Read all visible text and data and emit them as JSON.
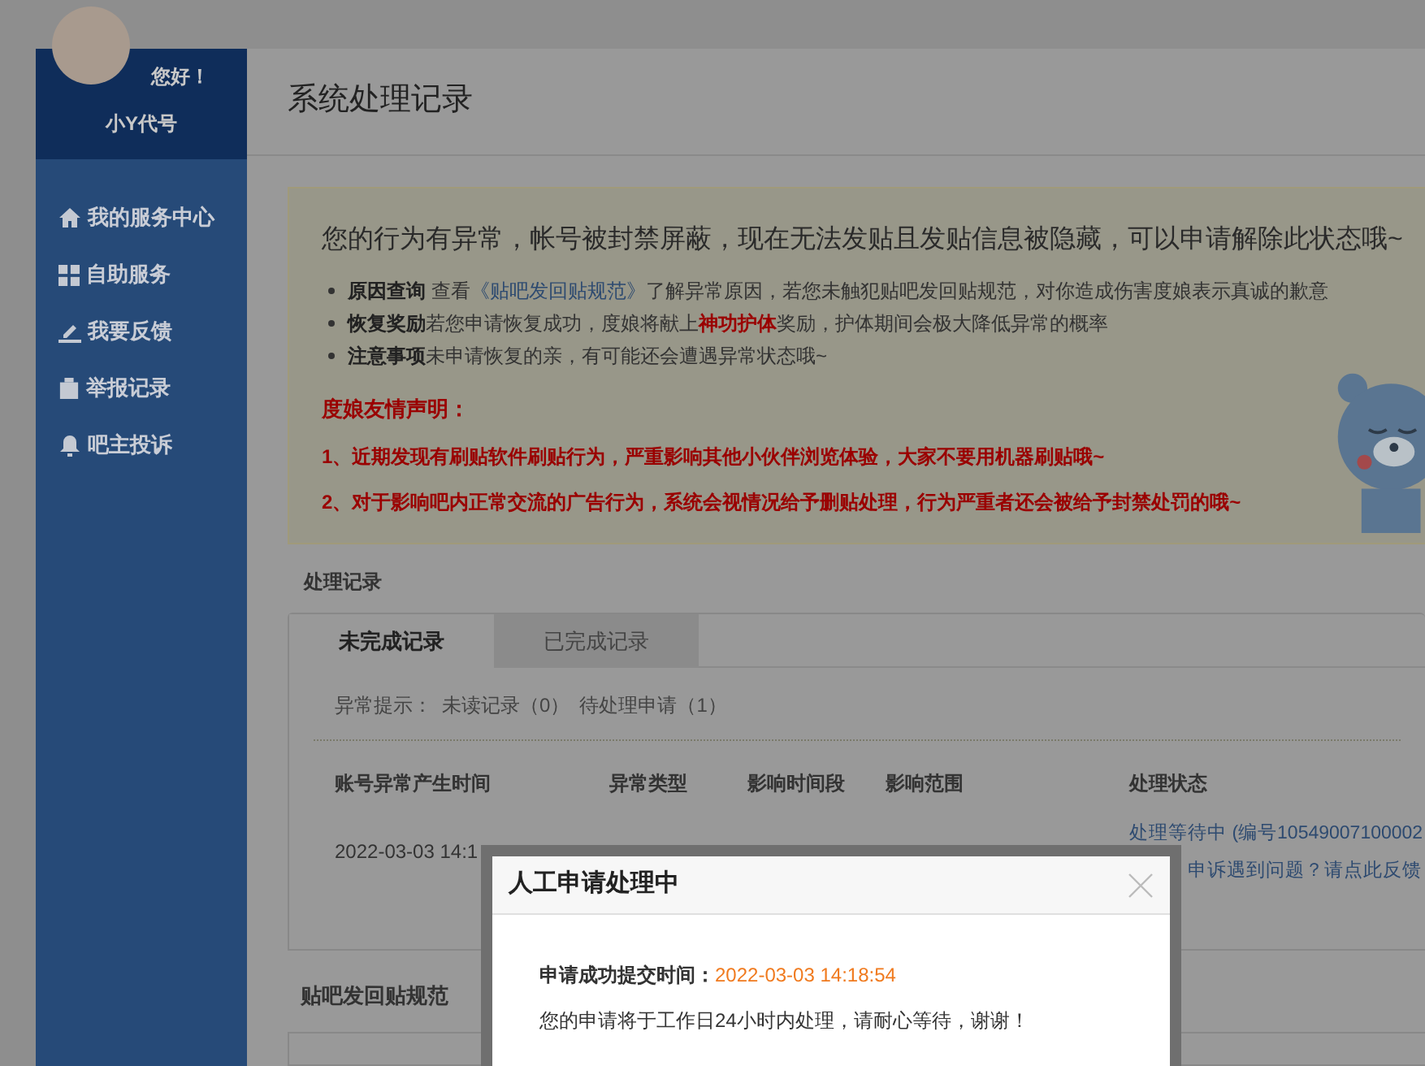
{
  "sidebar": {
    "greeting": "您好！",
    "username": "小Y代号",
    "items": [
      {
        "label": "我的服务中心"
      },
      {
        "label": "自助服务"
      },
      {
        "label": "我要反馈"
      },
      {
        "label": "举报记录"
      },
      {
        "label": "吧主投诉"
      }
    ]
  },
  "page_title": "系统处理记录",
  "notice": {
    "headline": "您的行为有异常，帐号被封禁屏蔽，现在无法发贴且发贴信息被隐藏，可以申请解除此状态哦~",
    "bullets": [
      {
        "segments": [
          {
            "kind": "term",
            "text": "原因查询"
          },
          {
            "kind": "plain",
            "text": " 查看"
          },
          {
            "kind": "link",
            "text": "《贴吧发回贴规范》"
          },
          {
            "kind": "plain",
            "text": "了解异常原因，若您未触犯贴吧发回贴规范，对你造成伤害度娘表示真诚的歉意"
          }
        ]
      },
      {
        "segments": [
          {
            "kind": "term",
            "text": "恢复奖励"
          },
          {
            "kind": "plain",
            "text": "若您申请恢复成功，度娘将献上"
          },
          {
            "kind": "highlight",
            "text": "神功护体"
          },
          {
            "kind": "plain",
            "text": "奖励，护体期间会极大降低异常的概率"
          }
        ]
      },
      {
        "segments": [
          {
            "kind": "term",
            "text": "注意事项"
          },
          {
            "kind": "plain",
            "text": "未申请恢复的亲，有可能还会遭遇异常状态哦~"
          }
        ]
      }
    ],
    "statement": {
      "title": "度娘友情声明：",
      "lines": [
        "1、近期发现有刷贴软件刷贴行为，严重影响其他小伙伴浏览体验，大家不要用机器刷贴哦~",
        "2、对于影响吧内正常交流的广告行为，系统会视情况给予删贴处理，行为严重者还会被给予封禁处罚的哦~"
      ]
    }
  },
  "records": {
    "title": "处理记录",
    "tabs": [
      {
        "label": "未完成记录",
        "selected": true
      },
      {
        "label": "已完成记录",
        "selected": false
      }
    ],
    "summary": {
      "label": "异常提示：",
      "unread": "未读记录（0）",
      "pending": "待处理申请（1）"
    },
    "columns": [
      "账号异常产生时间",
      "异常类型",
      "影响时间段",
      "影响范围",
      "处理状态"
    ],
    "rows": [
      {
        "time": "2022-03-03 14:1",
        "status": "处理等待中 (编号10549007100002",
        "feedback": "申诉遇到问题？请点此反馈"
      }
    ]
  },
  "rules_title": "贴吧发回贴规范",
  "dialog": {
    "title": "人工申请处理中",
    "submitted_label": "申请成功提交时间：",
    "submitted_time": "2022-03-03 14:18:54",
    "message": "您的申请将于工作日24小时内处理，请耐心等待，谢谢！"
  }
}
